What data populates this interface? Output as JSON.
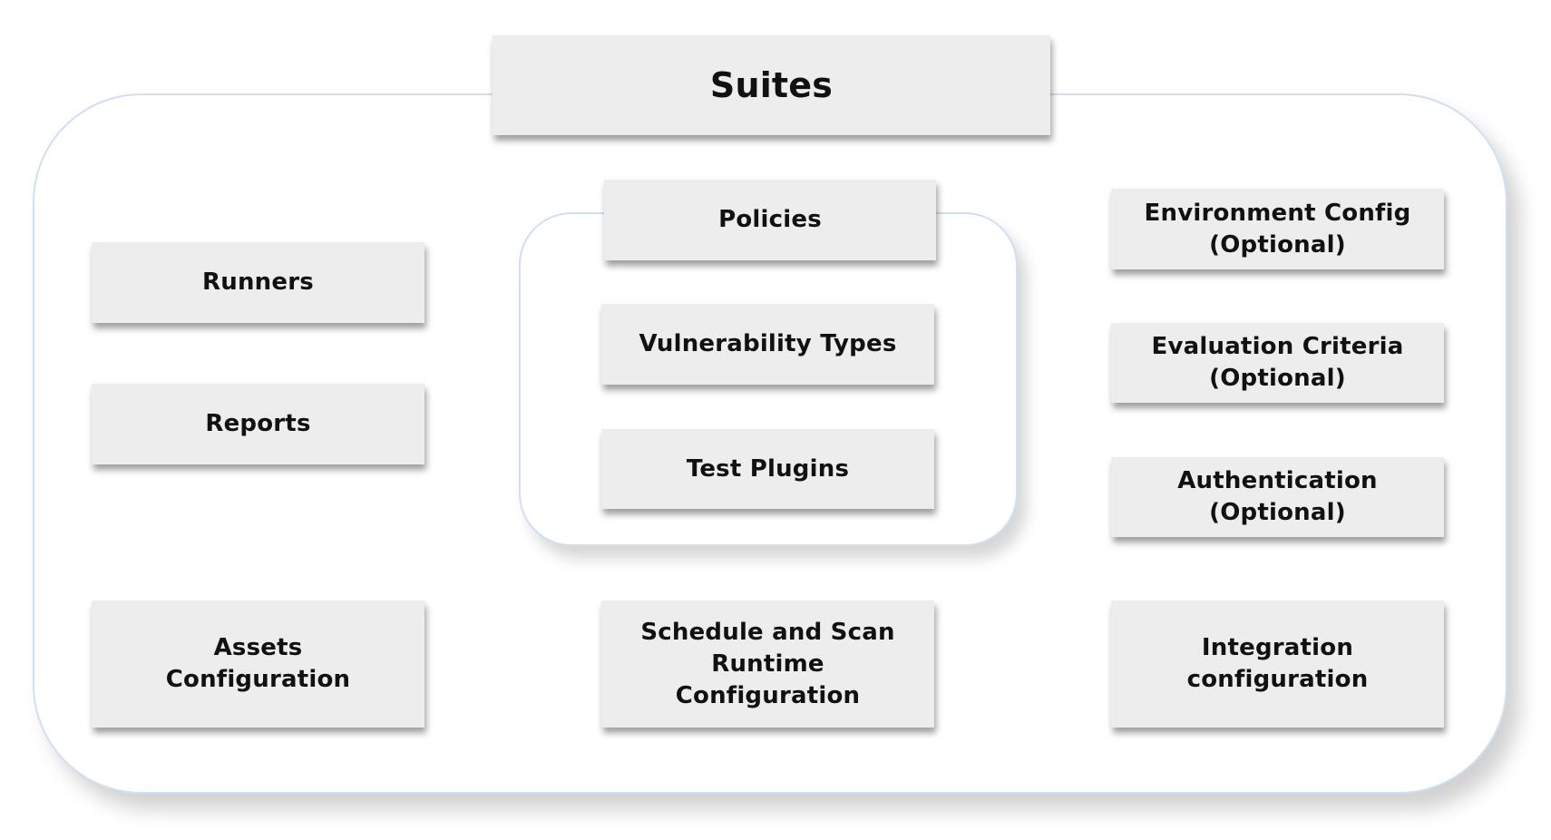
{
  "diagram": {
    "title": "Suites",
    "colors": {
      "frame_border": "#cfe0f3",
      "box_fill": "#ededed",
      "text": "#111111"
    },
    "groups": {
      "policies_group": {
        "label": "Policies",
        "items": [
          "Vulnerability Types",
          "Test Plugins"
        ]
      }
    },
    "nodes": {
      "runners": "Runners",
      "reports": "Reports",
      "assets_configuration": "Assets\nConfiguration",
      "schedule_and_scan": "Schedule and Scan\nRuntime\nConfiguration",
      "environment_config": "Environment Config\n(Optional)",
      "evaluation_criteria": "Evaluation Criteria\n(Optional)",
      "authentication": "Authentication\n(Optional)",
      "integration_configuration": "Integration\nconfiguration"
    }
  }
}
